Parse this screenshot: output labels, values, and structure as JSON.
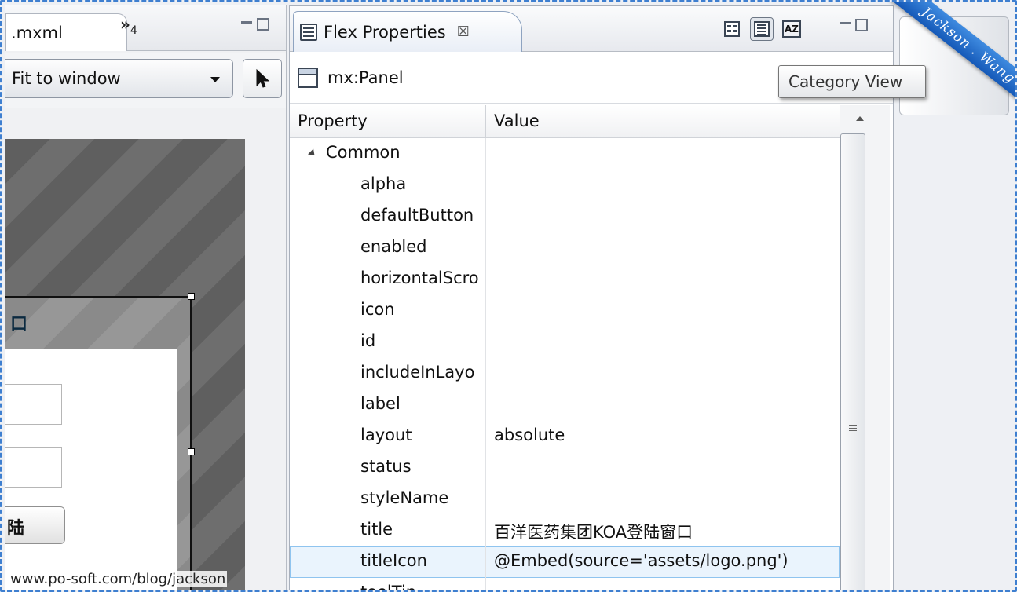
{
  "editor": {
    "tab_label": ".mxml",
    "overflow_label": "»",
    "overflow_count": "4",
    "zoom": {
      "value": "Fit to window"
    },
    "canvas": {
      "panel_title_fragment": "口",
      "login_button_fragment": "陆"
    }
  },
  "properties_view": {
    "tab_label": "Flex Properties",
    "tab_close": "☒",
    "component": "mx:Panel",
    "tooltip": "Category View",
    "view_buttons": [
      "standard-view",
      "category-view",
      "alphabetical-view"
    ],
    "alpha_button_label": "AZ",
    "columns": [
      "Property",
      "Value"
    ],
    "category": "Common",
    "rows": [
      {
        "name": "alpha",
        "value": ""
      },
      {
        "name": "defaultButton",
        "value": ""
      },
      {
        "name": "enabled",
        "value": ""
      },
      {
        "name": "horizontalScro",
        "value": ""
      },
      {
        "name": "icon",
        "value": ""
      },
      {
        "name": "id",
        "value": ""
      },
      {
        "name": "includeInLayo",
        "value": ""
      },
      {
        "name": "label",
        "value": ""
      },
      {
        "name": "layout",
        "value": "absolute"
      },
      {
        "name": "status",
        "value": ""
      },
      {
        "name": "styleName",
        "value": ""
      },
      {
        "name": "title",
        "value": "百洋医药集团KOA登陆窗口"
      },
      {
        "name": "titleIcon",
        "value": "@Embed(source='assets/logo.png')"
      },
      {
        "name": "toolTip",
        "value": ""
      }
    ],
    "selected_row": "titleIcon"
  },
  "overlays": {
    "url_watermark": "www.po-soft.com/blog/jackson",
    "corner_banner": "Jackson . Wang"
  },
  "colors": {
    "frame_border": "#3e7fd0",
    "selection": "#eaf4fd",
    "banner": "#1f6bd0"
  }
}
